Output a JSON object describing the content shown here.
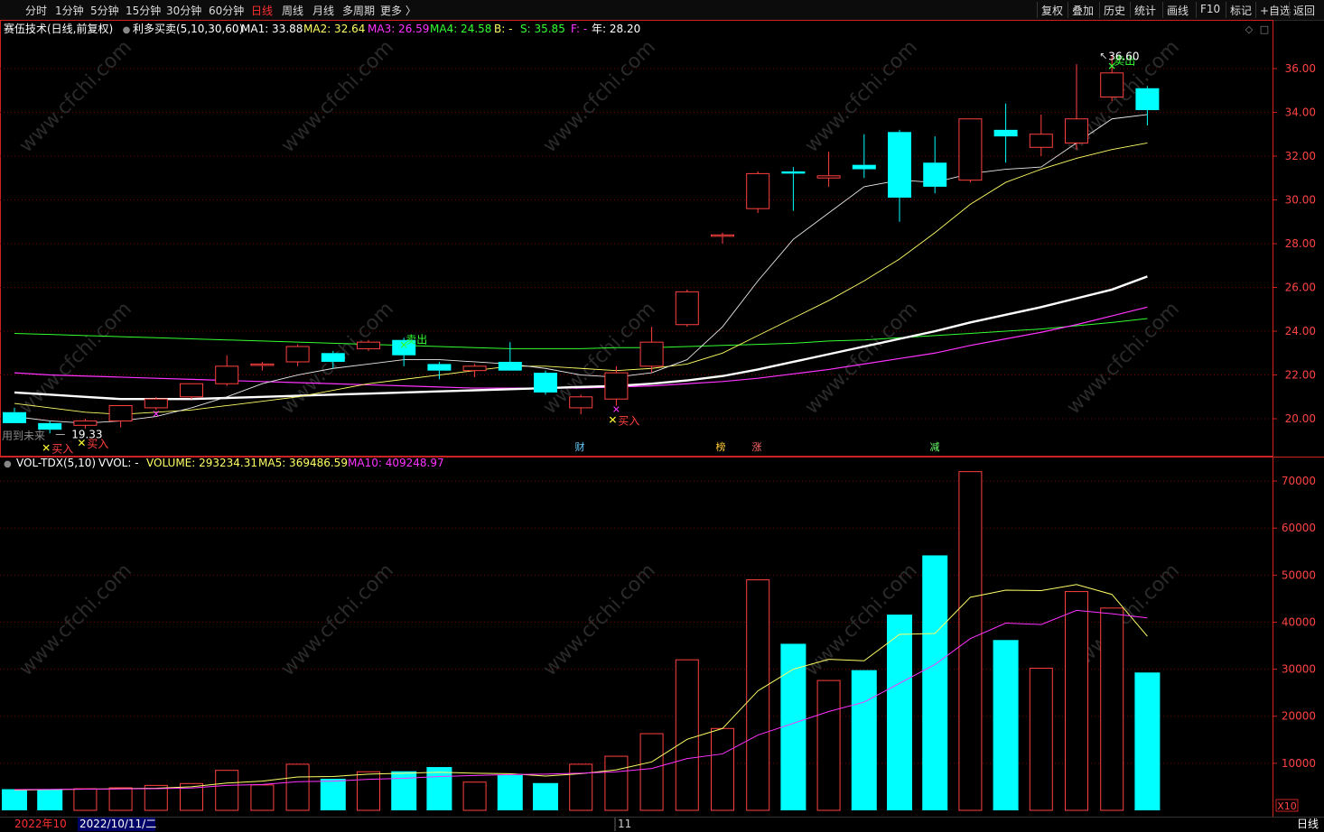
{
  "toolbar": {
    "left": [
      "分时",
      "1分钟",
      "5分钟",
      "15分钟",
      "30分钟",
      "60分钟",
      "日线",
      "周线",
      "月线",
      "多周期",
      "更多 〉"
    ],
    "active": "日线",
    "right": [
      "复权",
      "叠加",
      "历史",
      "统计",
      "画线",
      "F10",
      "标记",
      "+自选",
      "返回"
    ]
  },
  "main": {
    "stock": "赛伍技术(日线,前复权)",
    "indicator": "利多买卖(5,10,30,60)",
    "legend": [
      {
        "text": "MA1: 33.88",
        "color": "#ffffff"
      },
      {
        "text": "MA2: 32.64",
        "color": "#ffff66"
      },
      {
        "text": "MA3: 26.59",
        "color": "#ff33ff"
      },
      {
        "text": "MA4: 24.58",
        "color": "#33ff33"
      },
      {
        "text": "B: -",
        "color": "#ffff66"
      },
      {
        "text": "S: 35.85",
        "color": "#33ff33"
      },
      {
        "text": "F: -",
        "color": "#ff33ff"
      },
      {
        "text": "年: 28.20",
        "color": "#ffffff"
      }
    ],
    "yticks": [
      "36.00",
      "34.00",
      "32.00",
      "30.00",
      "28.00",
      "26.00",
      "24.00",
      "22.00",
      "20.00"
    ],
    "max_label": "36.60",
    "min_label": "19.33",
    "sell_label": "卖出",
    "buy_label": "买入",
    "hint": "用到未来",
    "events": [
      "财",
      "榜",
      "涨",
      "减"
    ]
  },
  "volume": {
    "indicator": "VOL-TDX(5,10)",
    "vvol": "VVOL: -",
    "legend": [
      {
        "text": "VOLUME: 293234.31",
        "color": "#ffff66"
      },
      {
        "text": "MA5: 369486.59",
        "color": "#ffff66"
      },
      {
        "text": "MA10: 409248.97",
        "color": "#ff33ff"
      }
    ],
    "yticks": [
      "70000",
      "60000",
      "50000",
      "40000",
      "30000",
      "20000",
      "10000"
    ],
    "unit": "X10"
  },
  "bottom": {
    "month1": "2022年10",
    "date": "2022/10/11/二",
    "month2": "11",
    "period": "日线"
  },
  "colors": {
    "up": "#ff4040",
    "down": "#00ffff",
    "ma1": "#ffffff",
    "ma2": "#ffff66",
    "ma3": "#ff33ff",
    "ma4": "#33ff33",
    "grid": "#7a0000",
    "axis": "#cc2222"
  },
  "chart_data": {
    "type": "candlestick",
    "candles": [
      {
        "o": 20.3,
        "h": 20.5,
        "l": 19.9,
        "c": 19.8,
        "v": 4500
      },
      {
        "o": 19.8,
        "h": 19.9,
        "l": 19.33,
        "c": 19.5,
        "v": 4500
      },
      {
        "o": 19.7,
        "h": 20.0,
        "l": 19.55,
        "c": 19.9,
        "v": 4600
      },
      {
        "o": 19.9,
        "h": 20.6,
        "l": 19.6,
        "c": 20.6,
        "v": 4800
      },
      {
        "o": 20.5,
        "h": 21.0,
        "l": 20.4,
        "c": 20.9,
        "v": 5300
      },
      {
        "o": 21.0,
        "h": 21.6,
        "l": 20.9,
        "c": 21.6,
        "v": 5700
      },
      {
        "o": 21.6,
        "h": 22.9,
        "l": 21.5,
        "c": 22.4,
        "v": 8500
      },
      {
        "o": 22.5,
        "h": 22.6,
        "l": 22.2,
        "c": 22.5,
        "v": 5400
      },
      {
        "o": 22.6,
        "h": 23.4,
        "l": 22.4,
        "c": 23.3,
        "v": 9800
      },
      {
        "o": 23.0,
        "h": 23.1,
        "l": 22.3,
        "c": 22.6,
        "v": 6700
      },
      {
        "o": 23.2,
        "h": 23.6,
        "l": 23.1,
        "c": 23.5,
        "v": 8200
      },
      {
        "o": 23.6,
        "h": 23.7,
        "l": 22.4,
        "c": 22.9,
        "v": 8300
      },
      {
        "o": 22.5,
        "h": 22.6,
        "l": 21.8,
        "c": 22.2,
        "v": 9200
      },
      {
        "o": 22.2,
        "h": 22.5,
        "l": 21.9,
        "c": 22.4,
        "v": 6000
      },
      {
        "o": 22.6,
        "h": 23.5,
        "l": 22.2,
        "c": 22.2,
        "v": 7500
      },
      {
        "o": 22.1,
        "h": 22.2,
        "l": 21.1,
        "c": 21.2,
        "v": 5800
      },
      {
        "o": 20.5,
        "h": 21.1,
        "l": 20.2,
        "c": 21.0,
        "v": 9800
      },
      {
        "o": 20.9,
        "h": 22.4,
        "l": 20.6,
        "c": 22.1,
        "v": 11500
      },
      {
        "o": 22.4,
        "h": 24.2,
        "l": 22.1,
        "c": 23.5,
        "v": 16300
      },
      {
        "o": 24.3,
        "h": 25.9,
        "l": 24.2,
        "c": 25.8,
        "v": 32000
      },
      {
        "o": 28.4,
        "h": 28.5,
        "l": 28.0,
        "c": 28.4,
        "v": 17400
      },
      {
        "o": 29.6,
        "h": 31.3,
        "l": 29.4,
        "c": 31.2,
        "v": 49000
      },
      {
        "o": 31.3,
        "h": 31.5,
        "l": 29.5,
        "c": 31.2,
        "v": 35400
      },
      {
        "o": 31.0,
        "h": 32.2,
        "l": 30.6,
        "c": 31.1,
        "v": 27600
      },
      {
        "o": 31.6,
        "h": 33.0,
        "l": 31.0,
        "c": 31.4,
        "v": 29800
      },
      {
        "o": 33.1,
        "h": 33.2,
        "l": 29.0,
        "c": 30.1,
        "v": 41600
      },
      {
        "o": 31.7,
        "h": 32.9,
        "l": 30.3,
        "c": 30.6,
        "v": 54200
      },
      {
        "o": 30.9,
        "h": 33.7,
        "l": 30.8,
        "c": 33.7,
        "v": 72000
      },
      {
        "o": 33.2,
        "h": 34.4,
        "l": 31.7,
        "c": 32.9,
        "v": 36200
      },
      {
        "o": 32.4,
        "h": 33.9,
        "l": 32.0,
        "c": 33.0,
        "v": 30200
      },
      {
        "o": 32.6,
        "h": 36.2,
        "l": 32.3,
        "c": 33.7,
        "v": 46500
      },
      {
        "o": 34.7,
        "h": 36.6,
        "l": 34.5,
        "c": 35.8,
        "v": 43000
      },
      {
        "o": 35.1,
        "h": 35.2,
        "l": 33.4,
        "c": 34.1,
        "v": 29300
      }
    ],
    "ma1": [
      20.1,
      19.9,
      19.8,
      19.9,
      20.1,
      20.5,
      21.0,
      21.6,
      22.0,
      22.3,
      22.5,
      22.7,
      22.7,
      22.6,
      22.5,
      22.3,
      22.0,
      21.9,
      22.1,
      22.7,
      24.2,
      26.3,
      28.2,
      29.4,
      30.6,
      30.9,
      30.8,
      31.2,
      31.4,
      31.5,
      32.6,
      33.7,
      33.9
    ],
    "ma2": [
      20.7,
      20.5,
      20.3,
      20.2,
      20.3,
      20.4,
      20.6,
      20.8,
      21.0,
      21.3,
      21.6,
      21.8,
      22.0,
      22.2,
      22.4,
      22.4,
      22.3,
      22.2,
      22.3,
      22.5,
      23.0,
      23.8,
      24.6,
      25.4,
      26.3,
      27.3,
      28.5,
      29.8,
      30.8,
      31.4,
      31.9,
      32.3,
      32.6
    ],
    "ma3": [
      21.2,
      21.1,
      21.0,
      20.9,
      20.9,
      20.9,
      20.95,
      21.0,
      21.05,
      21.1,
      21.15,
      21.2,
      21.25,
      21.3,
      21.35,
      21.4,
      21.45,
      21.5,
      21.6,
      21.75,
      21.95,
      22.25,
      22.6,
      22.95,
      23.3,
      23.65,
      24.0,
      24.4,
      24.75,
      25.1,
      25.5,
      25.9,
      26.5
    ],
    "ma4": [
      22.1,
      22.0,
      21.95,
      21.9,
      21.85,
      21.8,
      21.75,
      21.7,
      21.65,
      21.6,
      21.55,
      21.5,
      21.45,
      21.4,
      21.4,
      21.4,
      21.4,
      21.45,
      21.5,
      21.6,
      21.7,
      21.85,
      22.05,
      22.25,
      22.5,
      22.75,
      23.0,
      23.35,
      23.65,
      23.95,
      24.3,
      24.7,
      25.1
    ],
    "ma5": [
      23.9,
      23.85,
      23.8,
      23.75,
      23.7,
      23.65,
      23.6,
      23.55,
      23.5,
      23.45,
      23.4,
      23.35,
      23.3,
      23.25,
      23.2,
      23.2,
      23.2,
      23.25,
      23.25,
      23.3,
      23.35,
      23.4,
      23.45,
      23.55,
      23.6,
      23.7,
      23.8,
      23.9,
      24.0,
      24.1,
      24.25,
      24.4,
      24.58
    ],
    "vma5": [
      4300,
      4400,
      4500,
      4600,
      4700,
      5000,
      5800,
      6200,
      7100,
      7200,
      7700,
      7900,
      8100,
      7900,
      7800,
      7300,
      7800,
      8600,
      10300,
      15100,
      17400,
      25400,
      30000,
      32100,
      31800,
      37400,
      37600,
      45300,
      46800,
      46700,
      48000,
      45900,
      37000
    ],
    "vma10": [
      4400,
      4450,
      4500,
      4550,
      4600,
      4750,
      5300,
      5500,
      6100,
      6200,
      6600,
      6800,
      7200,
      7400,
      7600,
      7700,
      7900,
      8200,
      8900,
      11000,
      12000,
      16000,
      18500,
      21000,
      23000,
      27000,
      31000,
      36500,
      39800,
      39500,
      42500,
      41800,
      40900
    ],
    "ylim": [
      18.6,
      37.4
    ],
    "vol_ylim": [
      0,
      75000
    ],
    "signals": [
      {
        "i": 11,
        "type": "sell"
      },
      {
        "i": 31,
        "type": "sell"
      },
      {
        "i": 1,
        "type": "buy"
      },
      {
        "i": 2,
        "type": "buy"
      },
      {
        "i": 17,
        "type": "buy"
      },
      {
        "i": 4,
        "type": "f"
      },
      {
        "i": 17,
        "type": "f"
      }
    ]
  }
}
